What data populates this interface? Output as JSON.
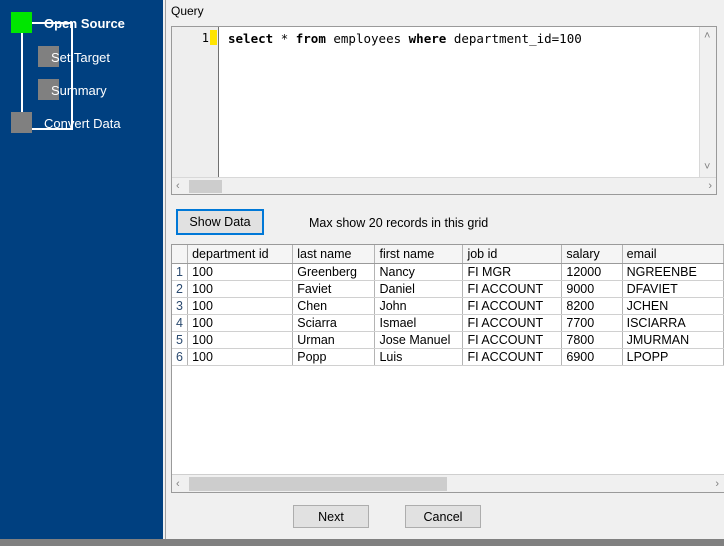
{
  "sidebar": {
    "steps": [
      {
        "label": "Open Source",
        "state": "active",
        "icon": "step-box-icon"
      },
      {
        "label": "Set Target",
        "state": "inactive",
        "icon": "step-box-icon"
      },
      {
        "label": "Summary",
        "state": "inactive",
        "icon": "step-box-icon"
      },
      {
        "label": "Convert Data",
        "state": "inactive",
        "icon": "step-box-icon"
      }
    ],
    "active_color": "#00e600",
    "inactive_color": "#808080",
    "background_color": "#004080"
  },
  "content": {
    "query_label": "Query",
    "editor": {
      "line_number": "1",
      "sql_tokens": [
        {
          "text": "select",
          "keyword": true
        },
        {
          "text": " ",
          "keyword": false
        },
        {
          "text": "*",
          "keyword": false
        },
        {
          "text": " ",
          "keyword": false
        },
        {
          "text": "from",
          "keyword": true
        },
        {
          "text": " employees ",
          "keyword": false
        },
        {
          "text": "where",
          "keyword": true
        },
        {
          "text": " department_id=100",
          "keyword": false
        }
      ],
      "sql_plain": "select * from employees where department_id=100",
      "vscroll_up_icon": "chevron-up-icon",
      "vscroll_down_icon": "chevron-down-icon",
      "hscroll_left_icon": "chevron-left-icon",
      "hscroll_right_icon": "chevron-right-icon"
    },
    "show_data_button": "Show Data",
    "max_records_note": "Max show 20 records in this grid",
    "grid": {
      "columns": [
        "department id",
        "last name",
        "first name",
        "job id",
        "salary",
        "email"
      ],
      "rows": [
        {
          "n": "1",
          "cells": [
            "100",
            "Greenberg",
            "Nancy",
            "FI MGR",
            "12000",
            "NGREENBE"
          ]
        },
        {
          "n": "2",
          "cells": [
            "100",
            "Faviet",
            "Daniel",
            "FI ACCOUNT",
            "9000",
            "DFAVIET"
          ]
        },
        {
          "n": "3",
          "cells": [
            "100",
            "Chen",
            "John",
            "FI ACCOUNT",
            "8200",
            "JCHEN"
          ]
        },
        {
          "n": "4",
          "cells": [
            "100",
            "Sciarra",
            "Ismael",
            "FI ACCOUNT",
            "7700",
            "ISCIARRA"
          ]
        },
        {
          "n": "5",
          "cells": [
            "100",
            "Urman",
            "Jose Manuel",
            "FI ACCOUNT",
            "7800",
            "JMURMAN"
          ]
        },
        {
          "n": "6",
          "cells": [
            "100",
            "Popp",
            "Luis",
            "FI ACCOUNT",
            "6900",
            "LPOPP"
          ]
        }
      ],
      "hscroll_left_icon": "chevron-left-icon",
      "hscroll_right_icon": "chevron-right-icon"
    }
  },
  "footer": {
    "next_label": "Next",
    "cancel_label": "Cancel"
  },
  "icons": {
    "chevron_up": "˄",
    "chevron_down": "˅",
    "chevron_left": "‹",
    "chevron_right": "›"
  }
}
